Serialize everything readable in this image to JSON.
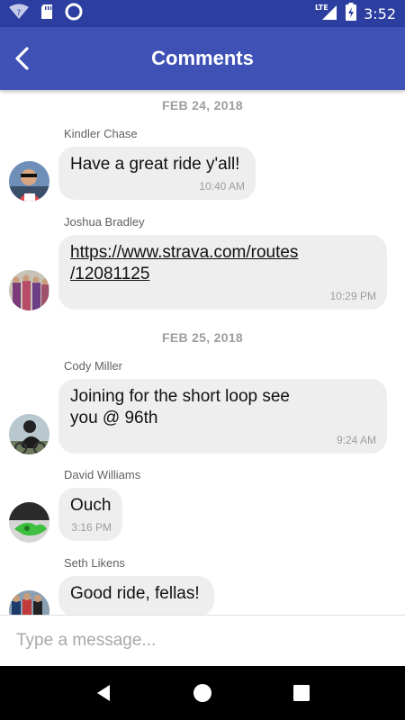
{
  "status_bar": {
    "time": "3:52",
    "network": "LTE"
  },
  "app_bar": {
    "title": "Comments"
  },
  "dates": [
    "FEB 24, 2018",
    "FEB 25, 2018"
  ],
  "messages": [
    {
      "sender": "Kindler Chase",
      "text": "Have a great ride y'all!",
      "time": "10:40 AM"
    },
    {
      "sender": "Joshua Bradley",
      "text": "https://www.strava.com/routes\n/12081125",
      "time": "10:29 PM"
    },
    {
      "sender": "Cody Miller",
      "text": "Joining for the short loop see\nyou @ 96th",
      "time": "9:24 AM"
    },
    {
      "sender": "David Williams",
      "text": "Ouch",
      "time": "3:16 PM"
    },
    {
      "sender": "Seth Likens",
      "text": "Good ride, fellas!",
      "time": ""
    }
  ],
  "composer": {
    "placeholder": "Type a message..."
  },
  "colors": {
    "status_bar": "#2c3ea0",
    "app_bar": "#3f51b5",
    "bubble": "#eeeeee"
  }
}
